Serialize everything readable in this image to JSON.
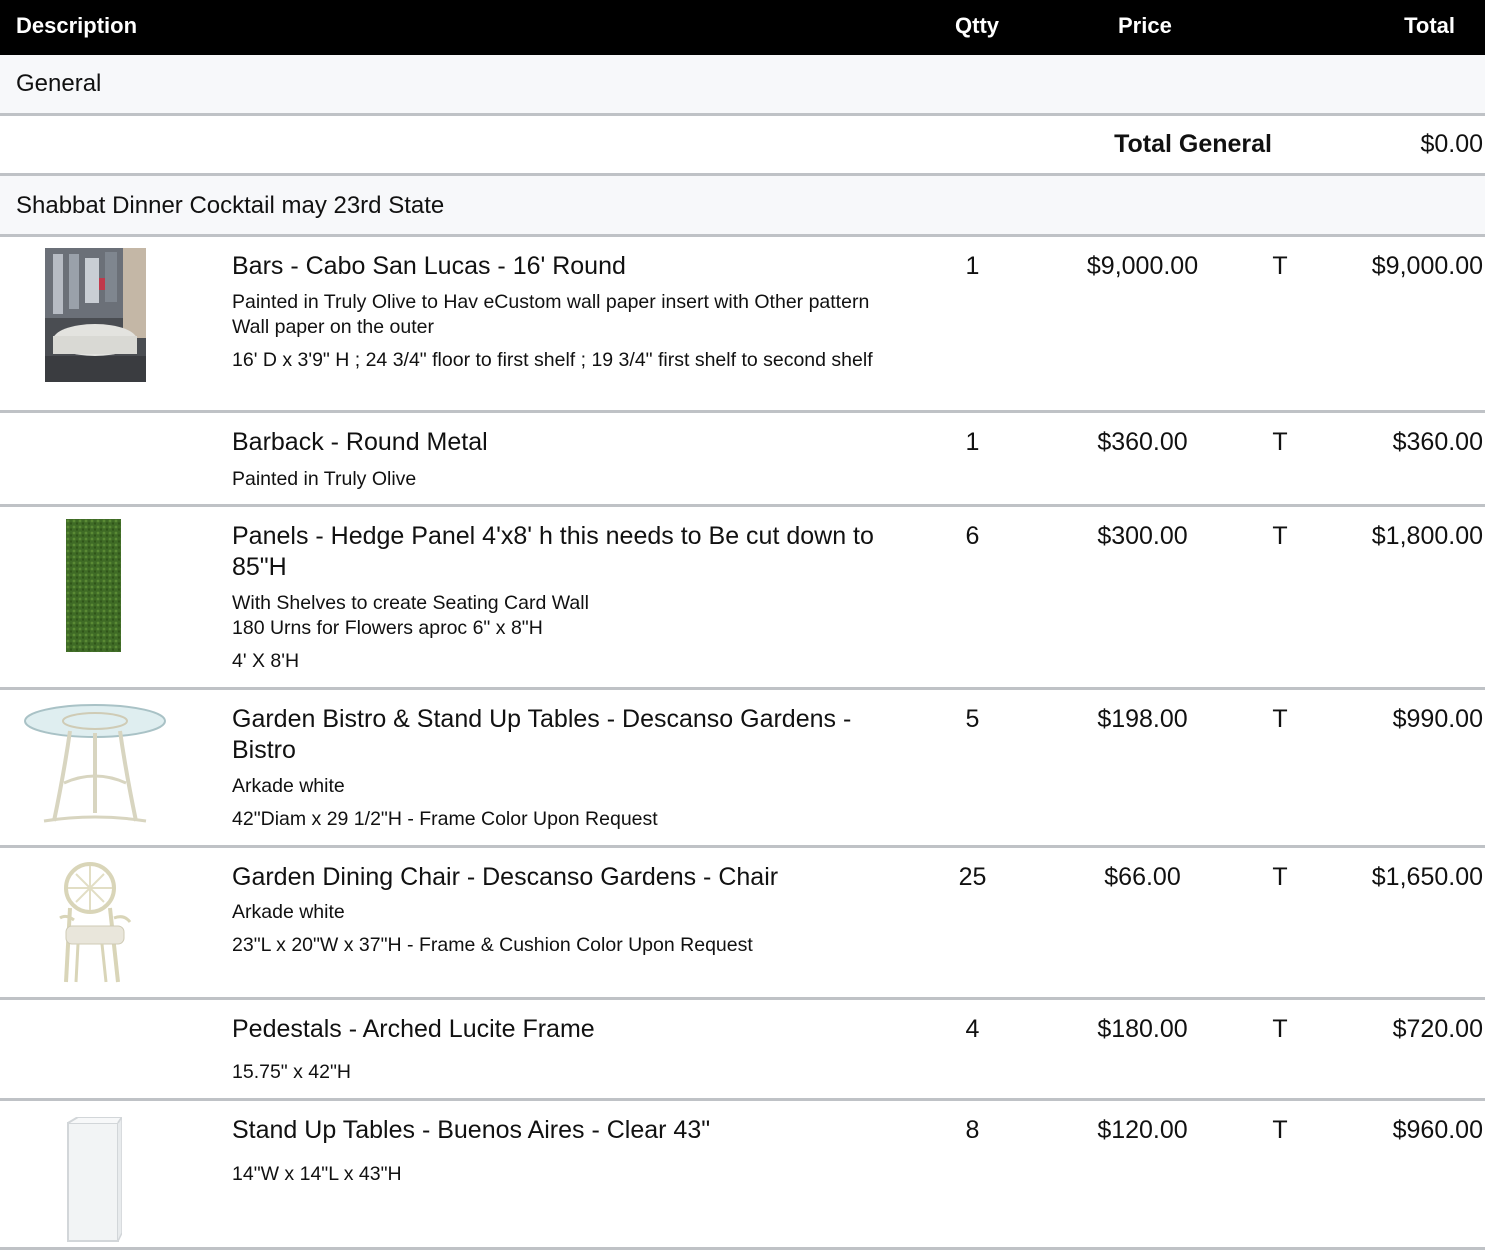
{
  "header": {
    "description": "Description",
    "qty": "Qtty",
    "price": "Price",
    "total": "Total"
  },
  "sections": [
    {
      "title": "General",
      "total_label": "Total General",
      "total_value": "$0.00"
    },
    {
      "title": "Shabbat Dinner Cocktail may 23rd State"
    }
  ],
  "items": [
    {
      "image": "bar-photo",
      "name": "Bars - Cabo San Lucas - 16' Round",
      "desc1": "Painted in Truly Olive to Hav eCustom wall paper insert  with Other pattern Wall paper on the outer",
      "desc2": "16' D x 3'9\" H ; 24 3/4\" floor to first shelf ; 19 3/4\" first shelf to second shelf",
      "qty": "1",
      "price": "$9,000.00",
      "tax": "T",
      "total": "$9,000.00"
    },
    {
      "name": "Barback - Round Metal",
      "desc1": "Painted in Truly Olive",
      "qty": "1",
      "price": "$360.00",
      "tax": "T",
      "total": "$360.00"
    },
    {
      "image": "hedge-panel-photo",
      "name": "Panels - Hedge Panel 4'x8' h this needs to Be cut down to  85\"H",
      "desc1": "With Shelves to create Seating Card Wall\n180 Urns for Flowers aproc 6\" x 8\"H",
      "desc2": "4' X 8'H",
      "qty": "6",
      "price": "$300.00",
      "tax": "T",
      "total": "$1,800.00"
    },
    {
      "image": "bistro-table-photo",
      "name": "Garden Bistro & Stand Up Tables - Descanso Gardens - Bistro",
      "desc1": "Arkade white",
      "desc2": "42\"Diam x 29 1/2\"H - Frame Color Upon Request",
      "qty": "5",
      "price": "$198.00",
      "tax": "T",
      "total": "$990.00"
    },
    {
      "image": "garden-chair-photo",
      "name": "Garden Dining Chair - Descanso Gardens - Chair",
      "desc1": "Arkade white",
      "desc2": "23\"L x 20\"W x 37\"H - Frame & Cushion Color Upon Request",
      "qty": "25",
      "price": "$66.00",
      "tax": "T",
      "total": "$1,650.00"
    },
    {
      "name": "Pedestals - Arched Lucite Frame",
      "desc2": "15.75\" x 42\"H",
      "qty": "4",
      "price": "$180.00",
      "tax": "T",
      "total": "$720.00"
    },
    {
      "image": "clear-table-photo",
      "name": "Stand Up Tables - Buenos Aires - Clear 43\"",
      "desc2": "14\"W x 14\"L x 43\"H",
      "qty": "8",
      "price": "$120.00",
      "tax": "T",
      "total": "$960.00"
    }
  ]
}
